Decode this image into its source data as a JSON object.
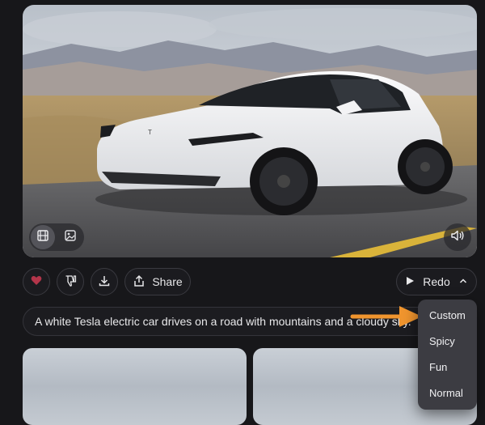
{
  "media": {
    "video_icon": "film-icon",
    "image_icon": "image-icon",
    "sound_icon": "speaker-icon"
  },
  "actions": {
    "like_icon": "heart-icon",
    "like_color": "#b3354a",
    "dislike_icon": "thumbs-down-icon",
    "download_icon": "download-icon",
    "share_label": "Share",
    "redo_label": "Redo"
  },
  "prompt": {
    "text": "A white Tesla electric car drives on a road with mountains and a cloudy sky."
  },
  "redo_menu": {
    "items": [
      {
        "label": "Custom"
      },
      {
        "label": "Spicy"
      },
      {
        "label": "Fun"
      },
      {
        "label": "Normal"
      }
    ]
  },
  "annotation": {
    "arrow_color": "#f0952e"
  }
}
